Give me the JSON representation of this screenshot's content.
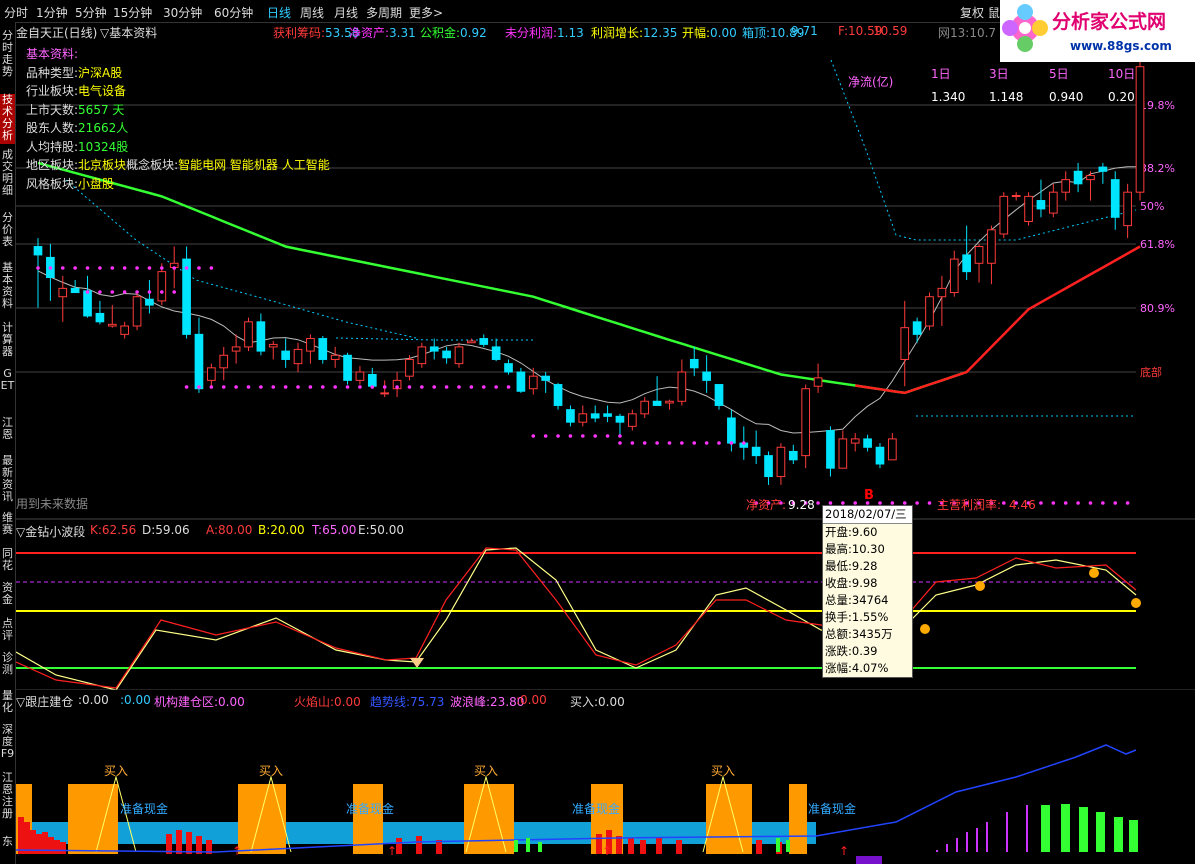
{
  "topbar": {
    "periods": [
      "分时",
      "1分钟",
      "5分钟",
      "15分钟",
      "30分钟",
      "60分钟",
      "日线",
      "周线",
      "月线",
      "多周期",
      "更多>"
    ],
    "right": "复权 鼠"
  },
  "sidebar": [
    "分时走势",
    "技术分析",
    "成交明细",
    "分价表",
    "基本资料",
    "计算器",
    "GET",
    "江恩",
    "最新资讯",
    "维赛",
    "同花",
    "资金",
    "点评",
    "诊测",
    "量化",
    "深度F9",
    "江恩注册",
    "东"
  ],
  "infobar": {
    "title": "金自天正(日线)",
    "menu": "▽基本资料",
    "items": [
      {
        "label": "获利筹码:",
        "value": "53.58"
      },
      {
        "label": "净资产:",
        "value": "3.31"
      },
      {
        "label": "公积金:",
        "value": "0.92"
      },
      {
        "label": "未分利润:",
        "value": "1.13"
      },
      {
        "label": "利润增长:",
        "value": "12.35"
      },
      {
        "label": "开幅:",
        "value": "0.00"
      },
      {
        "label": "箱顶:",
        "value": "10.89"
      },
      {
        "label": "",
        "value": "9.71"
      },
      {
        "label": "F:",
        "value": "10.59"
      },
      {
        "label": "",
        "value": "10.59"
      },
      {
        "label": "网13:",
        "value": "10.7"
      }
    ]
  },
  "basic_info": {
    "heading": "基本资料:",
    "rows": [
      {
        "label": "品种类型:",
        "value": "沪深A股"
      },
      {
        "label": "行业板块:",
        "value": "电气设备"
      },
      {
        "label": "上市天数:",
        "value": "5657 天"
      },
      {
        "label": "股东人数:",
        "value": "21662人"
      },
      {
        "label": "人均持股:",
        "value": "10324股"
      },
      {
        "label": "地区板块:",
        "value": "北京板块",
        "extra": "概念板块:",
        "extra_value": "智能电网 智能机器 人工智能"
      },
      {
        "label": "风格板块:",
        "value": "小盘股"
      }
    ]
  },
  "netflow": {
    "label": "净流(亿)",
    "periods": [
      "1日",
      "3日",
      "5日",
      "10日"
    ],
    "values": [
      "1.340",
      "1.148",
      "0.940",
      "0.20"
    ]
  },
  "fib_levels": [
    "19.8%",
    "38.2%",
    "50%",
    "61.8%",
    "80.9%",
    "底部"
  ],
  "main_bottom_texts": {
    "future": "用到未来数据",
    "netasset_label": "净资产:",
    "netasset_value": "9.28",
    "profit_label": "主营利润率:",
    "profit_value": "4.46",
    "marker": "B"
  },
  "tooltip": {
    "date": "2018/02/07/三",
    "rows": [
      {
        "label": "开盘:",
        "value": "9.60"
      },
      {
        "label": "最高:",
        "value": "10.30"
      },
      {
        "label": "最低:",
        "value": "9.28"
      },
      {
        "label": "收盘:",
        "value": "9.98"
      },
      {
        "label": "总量:",
        "value": "34764"
      },
      {
        "label": "换手:",
        "value": "1.55%"
      },
      {
        "label": "总额:",
        "value": "3435万"
      },
      {
        "label": "涨跌:",
        "value": "0.39"
      },
      {
        "label": "涨幅:",
        "value": "4.07%"
      }
    ]
  },
  "indicator1": {
    "name": "▽金钻小波段",
    "items": [
      {
        "label": "K:",
        "value": "62.56",
        "color": "#ff3b3b"
      },
      {
        "label": "D:",
        "value": "59.06",
        "color": "#dddddd"
      },
      {
        "label": "A:",
        "value": "80.00",
        "color": "#ff3b3b"
      },
      {
        "label": "B:",
        "value": "20.00",
        "color": "#ffff00"
      },
      {
        "label": "T:",
        "value": "65.00",
        "color": "#ff66ff"
      },
      {
        "label": "E:",
        "value": "50.00",
        "color": "#dddddd"
      }
    ]
  },
  "indicator2": {
    "name": "▽跟庄建仓",
    "items": [
      {
        "label": ":",
        "value": "0.00",
        "color": "#dddddd"
      },
      {
        "label": ":",
        "value": "0.00",
        "color": "#33ccff"
      },
      {
        "label": "机构建仓区:",
        "value": "0.00",
        "color": "#ff66ff"
      },
      {
        "label": "火焰山:",
        "value": "0.00",
        "color": "#ff3b3b"
      },
      {
        "label": "趋势线:",
        "value": "75.73",
        "color": "#3355ff"
      },
      {
        "label": "波浪峰:",
        "value": "23.80",
        "color": "#ff66ff"
      },
      {
        "label": ":",
        "value": "0.00",
        "color": "#ff3b3b"
      },
      {
        "label": "买入:",
        "value": "0.00",
        "color": "#dddddd"
      }
    ],
    "buy_label": "买入",
    "cash_label": "准备现金"
  },
  "logo": {
    "brand": "分析家公式网",
    "url": "www.88gs.com"
  },
  "colors": {
    "up": "#ff3b3b",
    "down": "#00e5ff",
    "ma_green": "#33ff33",
    "ma_red": "#ff2020",
    "accent": "#ff33ff"
  },
  "chart_data": {
    "type": "candlestick",
    "title": "金自天正(日线)",
    "candles": [
      [
        10.95,
        11.05,
        10.22,
        10.85
      ],
      [
        10.82,
        10.98,
        10.3,
        10.58
      ],
      [
        10.35,
        10.6,
        10.05,
        10.45
      ],
      [
        10.45,
        10.55,
        10.4,
        10.4
      ],
      [
        10.42,
        10.6,
        10.1,
        10.12
      ],
      [
        10.15,
        10.3,
        10.02,
        10.05
      ],
      [
        10.0,
        10.25,
        9.98,
        10.02
      ],
      [
        9.9,
        10.05,
        9.85,
        10.0
      ],
      [
        10.0,
        10.4,
        9.95,
        10.35
      ],
      [
        10.32,
        10.55,
        10.15,
        10.25
      ],
      [
        10.3,
        10.75,
        10.25,
        10.65
      ],
      [
        10.7,
        10.95,
        10.45,
        10.75
      ],
      [
        10.8,
        10.95,
        9.85,
        9.9
      ],
      [
        9.9,
        10.1,
        9.2,
        9.25
      ],
      [
        9.35,
        9.55,
        9.25,
        9.5
      ],
      [
        9.5,
        9.75,
        9.35,
        9.65
      ],
      [
        9.7,
        9.9,
        9.55,
        9.75
      ],
      [
        9.75,
        10.1,
        9.7,
        10.05
      ],
      [
        10.05,
        10.15,
        9.65,
        9.7
      ],
      [
        9.75,
        9.82,
        9.6,
        9.78
      ],
      [
        9.7,
        9.85,
        9.5,
        9.6
      ],
      [
        9.55,
        9.8,
        9.45,
        9.72
      ],
      [
        9.7,
        9.9,
        9.55,
        9.85
      ],
      [
        9.85,
        9.88,
        9.55,
        9.6
      ],
      [
        9.6,
        9.75,
        9.5,
        9.65
      ],
      [
        9.65,
        9.68,
        9.3,
        9.35
      ],
      [
        9.35,
        9.52,
        9.3,
        9.45
      ],
      [
        9.42,
        9.5,
        9.25,
        9.28
      ],
      [
        9.2,
        9.35,
        9.15,
        9.2
      ],
      [
        9.25,
        9.45,
        9.15,
        9.35
      ],
      [
        9.4,
        9.65,
        9.35,
        9.6
      ],
      [
        9.55,
        9.8,
        9.5,
        9.75
      ],
      [
        9.75,
        9.85,
        9.6,
        9.7
      ],
      [
        9.7,
        9.75,
        9.55,
        9.62
      ],
      [
        9.55,
        9.8,
        9.5,
        9.75
      ],
      [
        9.8,
        9.85,
        9.8,
        9.82
      ],
      [
        9.85,
        9.9,
        9.75,
        9.78
      ],
      [
        9.75,
        9.85,
        9.58,
        9.6
      ],
      [
        9.55,
        9.6,
        9.42,
        9.45
      ],
      [
        9.45,
        9.5,
        9.2,
        9.22
      ],
      [
        9.25,
        9.5,
        9.18,
        9.4
      ],
      [
        9.4,
        9.45,
        9.2,
        9.35
      ],
      [
        9.3,
        9.32,
        9.0,
        9.05
      ],
      [
        9.0,
        9.05,
        8.8,
        8.85
      ],
      [
        8.85,
        9.05,
        8.8,
        8.95
      ],
      [
        8.95,
        9.05,
        8.85,
        8.9
      ],
      [
        8.95,
        9.05,
        8.85,
        8.92
      ],
      [
        8.92,
        8.95,
        8.7,
        8.85
      ],
      [
        8.8,
        9.0,
        8.75,
        8.95
      ],
      [
        8.95,
        9.15,
        8.9,
        9.1
      ],
      [
        9.1,
        9.4,
        9.05,
        9.05
      ],
      [
        9.08,
        9.12,
        9.0,
        9.1
      ],
      [
        9.1,
        9.6,
        9.05,
        9.45
      ],
      [
        9.6,
        9.75,
        9.4,
        9.5
      ],
      [
        9.45,
        9.65,
        9.2,
        9.35
      ],
      [
        9.3,
        9.3,
        9.0,
        9.05
      ],
      [
        8.9,
        9.0,
        8.5,
        8.6
      ],
      [
        8.6,
        8.8,
        8.4,
        8.55
      ],
      [
        8.55,
        8.75,
        8.35,
        8.45
      ],
      [
        8.45,
        8.5,
        8.1,
        8.2
      ],
      [
        8.2,
        8.6,
        8.1,
        8.55
      ],
      [
        8.5,
        8.58,
        8.35,
        8.4
      ],
      [
        8.45,
        9.3,
        8.3,
        9.25
      ],
      [
        9.28,
        9.55,
        9.2,
        9.38
      ],
      [
        8.75,
        8.8,
        8.2,
        8.3
      ],
      [
        8.3,
        8.75,
        8.3,
        8.65
      ],
      [
        8.6,
        8.72,
        8.5,
        8.65
      ],
      [
        8.65,
        8.7,
        8.5,
        8.55
      ],
      [
        8.55,
        8.6,
        8.3,
        8.35
      ],
      [
        8.4,
        8.72,
        8.4,
        8.65
      ],
      [
        9.6,
        10.3,
        9.28,
        9.98
      ],
      [
        10.05,
        10.1,
        9.8,
        9.9
      ],
      [
        10.0,
        10.4,
        9.95,
        10.35
      ],
      [
        10.35,
        10.6,
        10.0,
        10.45
      ],
      [
        10.4,
        10.9,
        10.35,
        10.8
      ],
      [
        10.85,
        11.2,
        10.55,
        10.65
      ],
      [
        10.75,
        10.98,
        10.52,
        10.95
      ],
      [
        10.75,
        11.2,
        10.5,
        11.15
      ],
      [
        11.1,
        11.6,
        11.05,
        11.55
      ],
      [
        11.55,
        11.6,
        11.5,
        11.56
      ],
      [
        11.25,
        11.6,
        11.2,
        11.55
      ],
      [
        11.5,
        11.75,
        11.3,
        11.4
      ],
      [
        11.35,
        11.7,
        11.3,
        11.6
      ],
      [
        11.6,
        11.85,
        11.5,
        11.75
      ],
      [
        11.85,
        11.95,
        11.6,
        11.7
      ],
      [
        11.75,
        11.85,
        11.5,
        11.8
      ],
      [
        11.9,
        11.95,
        11.7,
        11.85
      ],
      [
        11.75,
        11.85,
        11.15,
        11.3
      ],
      [
        11.2,
        11.7,
        11.05,
        11.6
      ],
      [
        11.6,
        13.2,
        11.5,
        13.1
      ]
    ],
    "ma_green_points": [
      [
        0,
        11.95
      ],
      [
        10,
        11.55
      ],
      [
        20,
        10.95
      ],
      [
        30,
        10.65
      ],
      [
        40,
        10.35
      ],
      [
        50,
        9.88
      ],
      [
        60,
        9.42
      ],
      [
        70,
        9.2
      ],
      [
        75,
        9.45
      ],
      [
        80,
        10.2
      ],
      [
        89,
        10.95
      ]
    ],
    "ylim": [
      7.8,
      13.3
    ]
  }
}
